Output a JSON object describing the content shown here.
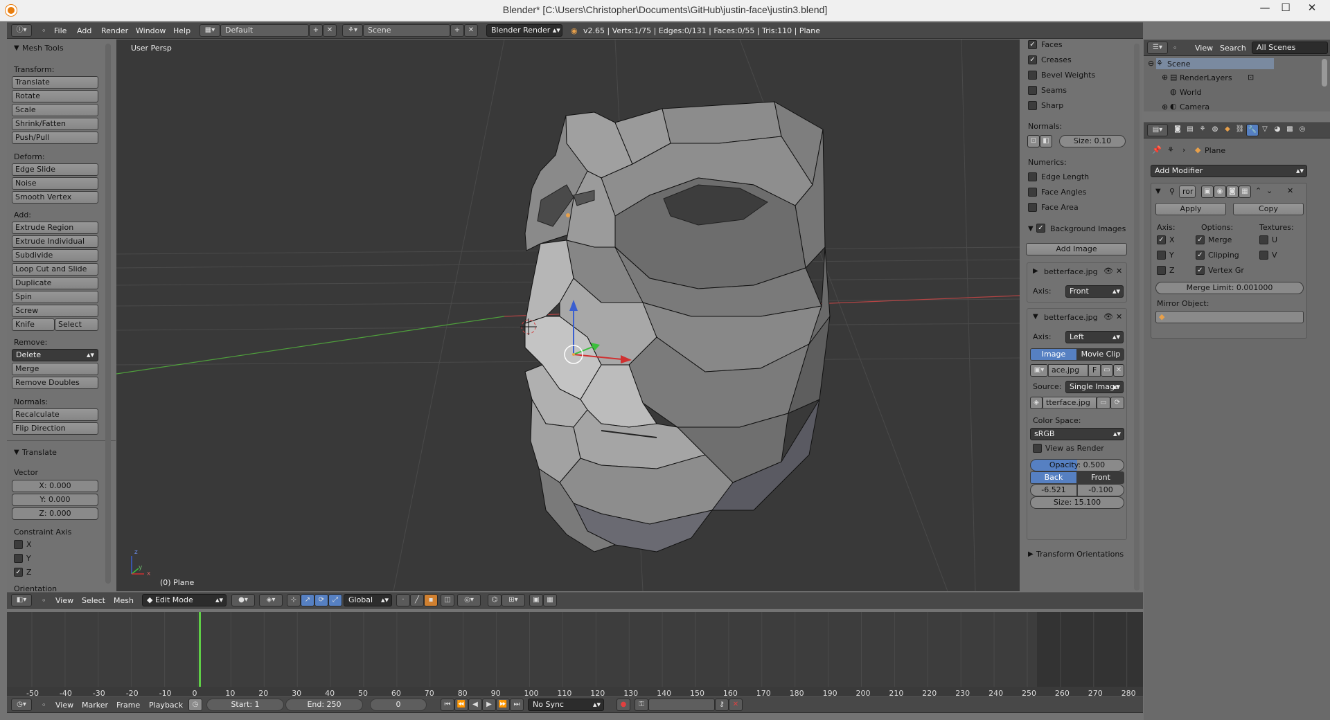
{
  "window": {
    "title": "Blender* [C:\\Users\\Christopher\\Documents\\GitHub\\justin-face\\justin3.blend]",
    "min": "—",
    "max": "☐",
    "close": "✕"
  },
  "info_header": {
    "menus": [
      "File",
      "Add",
      "Render",
      "Window",
      "Help"
    ],
    "layout": "Default",
    "scene": "Scene",
    "engine": "Blender Render",
    "stats": "v2.65 | Verts:1/75 | Edges:0/131 | Faces:0/55 | Tris:110 | Plane"
  },
  "toolshelf": {
    "title": "Mesh Tools",
    "transform_label": "Transform:",
    "transform": [
      "Translate",
      "Rotate",
      "Scale",
      "Shrink/Fatten",
      "Push/Pull"
    ],
    "deform_label": "Deform:",
    "deform": [
      "Edge Slide",
      "Noise",
      "Smooth Vertex"
    ],
    "add_label": "Add:",
    "add": [
      "Extrude Region",
      "Extrude Individual",
      "Subdivide",
      "Loop Cut and Slide",
      "Duplicate",
      "Spin",
      "Screw"
    ],
    "knife": "Knife",
    "select": "Select",
    "remove_label": "Remove:",
    "delete": "Delete",
    "remove": [
      "Merge",
      "Remove Doubles"
    ],
    "normals_label": "Normals:",
    "normals": [
      "Recalculate",
      "Flip Direction"
    ],
    "op_title": "Translate",
    "vector_label": "Vector",
    "vx": "X: 0.000",
    "vy": "Y: 0.000",
    "vz": "Z: 0.000",
    "constraint_label": "Constraint Axis",
    "cx": "X",
    "cy": "Y",
    "cz": "Z",
    "orientation": "Orientation"
  },
  "viewport": {
    "label": "User Persp",
    "object": "(0) Plane",
    "axis_x": "x",
    "axis_y": "y",
    "axis_z": "z"
  },
  "view_header": {
    "menus": [
      "View",
      "Select",
      "Mesh"
    ],
    "mode": "Edit Mode",
    "orientation": "Global"
  },
  "props": {
    "faces": "Faces",
    "creases": "Creases",
    "bevel": "Bevel Weights",
    "seams": "Seams",
    "sharp": "Sharp",
    "normals_label": "Normals:",
    "size": "Size: 0.10",
    "numerics_label": "Numerics:",
    "edge_length": "Edge Length",
    "face_angles": "Face Angles",
    "face_area": "Face Area",
    "bg_title": "Background Images",
    "add_image": "Add Image",
    "img1": "betterface.jpg",
    "axis_label": "Axis:",
    "img1_axis": "Front",
    "img2": "betterface.jpg",
    "img2_axis": "Left",
    "tab_image": "Image",
    "tab_movie": "Movie Clip",
    "file_short": "ace.jpg",
    "f_btn": "F",
    "source_label": "Source:",
    "source": "Single Image",
    "path": "tterface.jpg",
    "color_space_label": "Color Space:",
    "color_space": "sRGB",
    "view_render": "View as Render",
    "opacity_label": "Opacity:",
    "opacity": "0.500",
    "back": "Back",
    "front": "Front",
    "offx": "-6.521",
    "offy": "-0.100",
    "bsize": "Size: 15.100",
    "transform_orient": "Transform Orientations"
  },
  "outliner": {
    "menus": [
      "View",
      "Search"
    ],
    "filter": "All Scenes",
    "items": [
      "Scene",
      "RenderLayers",
      "World",
      "Camera"
    ]
  },
  "modifier": {
    "object": "Plane",
    "add_modifier": "Add Modifier",
    "name": "ror",
    "apply": "Apply",
    "copy": "Copy",
    "axis_label": "Axis:",
    "options_label": "Options:",
    "textures_label": "Textures:",
    "ax": "X",
    "ay": "Y",
    "az": "Z",
    "merge": "Merge",
    "clipping": "Clipping",
    "vertex": "Vertex Gr",
    "u": "U",
    "v": "V",
    "merge_limit": "Merge Limit: 0.001000",
    "mirror_obj": "Mirror Object:"
  },
  "timeline": {
    "ticks": [
      "-50",
      "-40",
      "-30",
      "-20",
      "-10",
      "0",
      "10",
      "20",
      "30",
      "40",
      "50",
      "60",
      "70",
      "80",
      "90",
      "100",
      "110",
      "120",
      "130",
      "140",
      "150",
      "160",
      "170",
      "180",
      "190",
      "200",
      "210",
      "220",
      "230",
      "240",
      "250",
      "260",
      "270",
      "280"
    ],
    "menus": [
      "View",
      "Marker",
      "Frame",
      "Playback"
    ],
    "start": "Start: 1",
    "end": "End: 250",
    "current": "0",
    "sync": "No Sync"
  },
  "colors": {
    "accent": "#5680c2",
    "frame_marker": "#5fd046",
    "x_axis": "#b44444",
    "y_axis": "#4fa03c"
  }
}
